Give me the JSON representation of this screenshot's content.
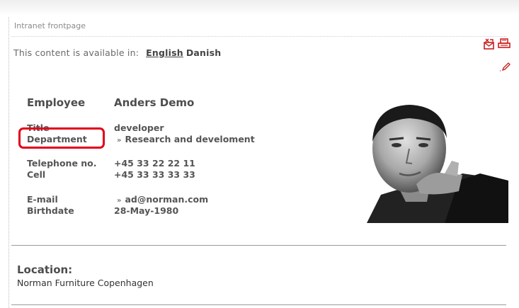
{
  "breadcrumb": "Intranet frontpage",
  "language": {
    "prompt": "This content is available in:",
    "options": [
      "English",
      "Danish"
    ],
    "active": "English"
  },
  "actions": {
    "email_icon": "email-icon",
    "print_icon": "print-icon",
    "edit_icon": "edit-pencil-icon",
    "accent_color": "#cc1a1a"
  },
  "employee": {
    "heading_label": "Employee",
    "name": "Anders Demo",
    "fields": {
      "title": {
        "label": "Title",
        "value": "developer"
      },
      "department": {
        "label": "Department",
        "value": "Research and develoment"
      },
      "telephone": {
        "label": "Telephone no.",
        "value": "+45 33 22 22 11"
      },
      "cell": {
        "label": "Cell",
        "value": "+45 33 33 33 33"
      },
      "email": {
        "label": "E-mail",
        "value": "ad@norman.com"
      },
      "birthdate": {
        "label": "Birthdate",
        "value": "28-May-1980"
      }
    },
    "link_arrow": "»"
  },
  "location": {
    "heading": "Location:",
    "value": "Norman Furniture Copenhagen"
  },
  "highlight_color": "#e2001a"
}
